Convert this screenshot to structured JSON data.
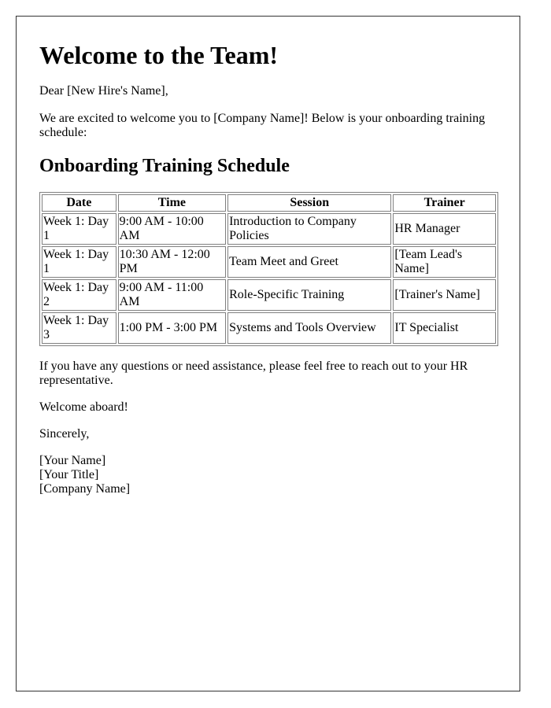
{
  "letter": {
    "title": "Welcome to the Team!",
    "salutation": "Dear [New Hire's Name],",
    "intro": "We are excited to welcome you to [Company Name]! Below is your onboarding training schedule:",
    "schedule_heading": "Onboarding Training Schedule",
    "table": {
      "headers": [
        "Date",
        "Time",
        "Session",
        "Trainer"
      ],
      "rows": [
        {
          "date": "Week 1: Day 1",
          "time": "9:00 AM - 10:00 AM",
          "session": "Introduction to Company Policies",
          "trainer": "HR Manager"
        },
        {
          "date": "Week 1: Day 1",
          "time": "10:30 AM - 12:00 PM",
          "session": "Team Meet and Greet",
          "trainer": "[Team Lead's Name]"
        },
        {
          "date": "Week 1: Day 2",
          "time": "9:00 AM - 11:00 AM",
          "session": "Role-Specific Training",
          "trainer": "[Trainer's Name]"
        },
        {
          "date": "Week 1: Day 3",
          "time": "1:00 PM - 3:00 PM",
          "session": "Systems and Tools Overview",
          "trainer": "IT Specialist"
        }
      ]
    },
    "questions": "If you have any questions or need assistance, please feel free to reach out to your HR representative.",
    "closing_note": "Welcome aboard!",
    "signoff": "Sincerely,",
    "signature": {
      "name": "[Your Name]",
      "title": "[Your Title]",
      "company": "[Company Name]"
    }
  },
  "colors": {
    "border": "#333333",
    "table_border": "#808080",
    "text": "#000000",
    "background": "#ffffff"
  }
}
